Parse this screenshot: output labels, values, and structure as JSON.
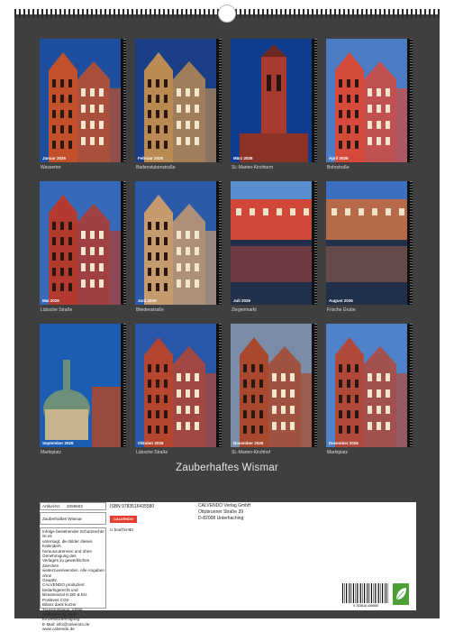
{
  "calendar": {
    "title": "Zauberhaftes Wismar",
    "months": [
      {
        "label": "Januar 2026",
        "caption": "Wassertor",
        "icon": "brick-gate-icon"
      },
      {
        "label": "Februar 2026",
        "caption": "Badenstubenstraße",
        "icon": "gabled-house-icon"
      },
      {
        "label": "März 2026",
        "caption": "St.-Marien-Kirchturm",
        "icon": "church-tower-icon"
      },
      {
        "label": "April 2026",
        "caption": "Bohrstraße",
        "icon": "gabled-houses-icon"
      },
      {
        "label": "Mai 2026",
        "caption": "Lübsche Straße",
        "icon": "street-houses-icon"
      },
      {
        "label": "Juni 2026",
        "caption": "Bliedenstraße",
        "icon": "street-church-icon"
      },
      {
        "label": "Juli 2026",
        "caption": "Ziegenmarkt",
        "icon": "half-timbered-canal-icon"
      },
      {
        "label": "August 2026",
        "caption": "Frische Grube",
        "icon": "canal-houses-icon"
      },
      {
        "label": "September 2026",
        "caption": "Marktplatz",
        "icon": "wasserkunst-pavilion-icon"
      },
      {
        "label": "Oktober 2026",
        "caption": "Lübsche Straße",
        "icon": "street-tower-icon"
      },
      {
        "label": "November 2026",
        "caption": "St.-Marien-Kirchhof",
        "icon": "brick-facade-icon"
      },
      {
        "label": "Dezember 2026",
        "caption": "Marktplatz",
        "icon": "alter-schwede-icon"
      }
    ]
  },
  "product": {
    "article_label": "Artikel-Nr.",
    "article_number": "2059602",
    "product_title": "Zauberhaftes Wismar",
    "isbn": "ISBN 9783516435580",
    "cover_note": "U boaTicHEr",
    "publisher_name": "CALVENDO Verlag GmbH",
    "publisher_street": "Ottobrunner Straße 39",
    "publisher_city": "D-82008 Unterhaching",
    "logo_text": "CALVENDO",
    "barcode_digits": "9 783516 435580",
    "legal_text": [
      "Infolge bestehender Schutzrechte ist es",
      "untersagt, die Bilder dieses Kalenders",
      "herauszutrennen und ohne Genehmigung des",
      "Verlages zu gewerblichen Zwecken",
      "weiterzuverwenden. Alle Angaben ohne",
      "Gewähr.",
      "CALVENDO produziert bedarfsgerecht und",
      "klimaneutral in DE & EU. Positives CO2-",
      "Bilanz dank kurzer Transportwege, Abfall-",
      "Reduzierung dank Einzelstückfertigung.",
      "E-Mail: info@calvendo.de",
      "www.calvendo.de"
    ]
  }
}
